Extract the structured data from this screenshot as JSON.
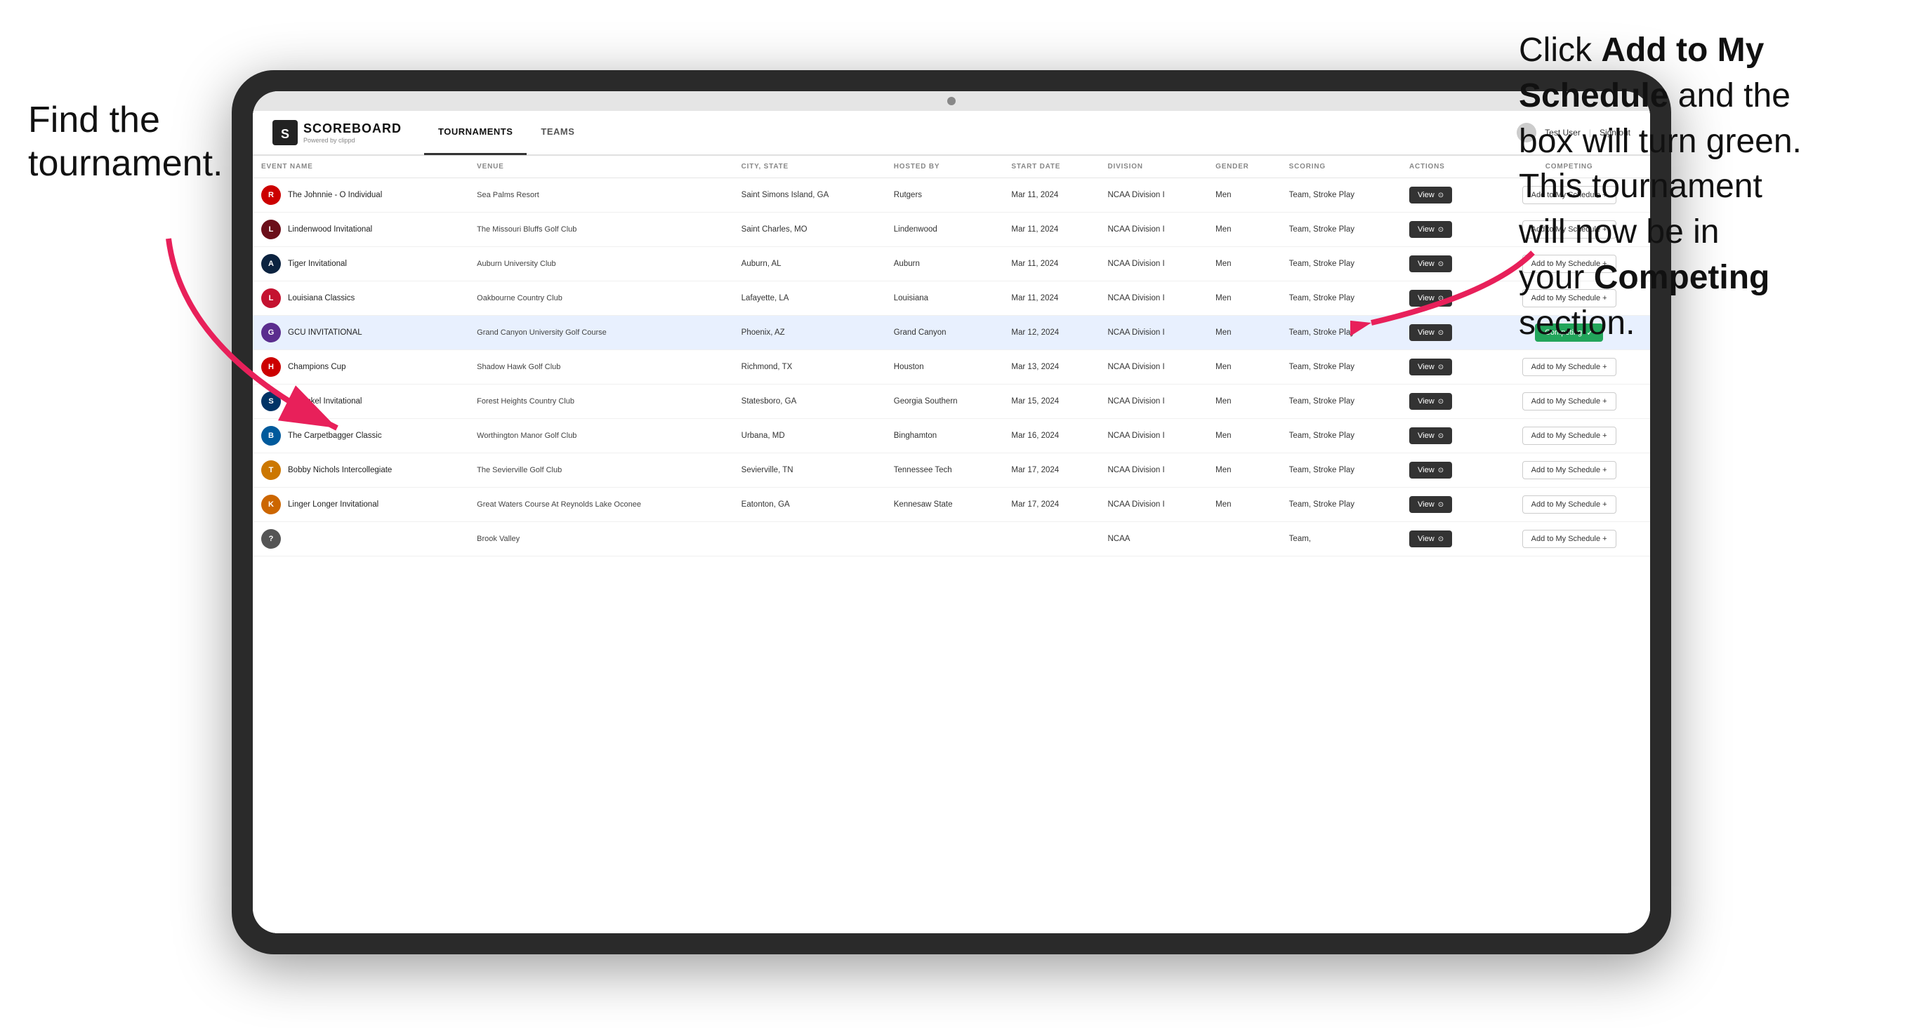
{
  "annotations": {
    "left": "Find the\ntournament.",
    "right_line1": "Click ",
    "right_bold1": "Add to My\nSchedule",
    "right_line2": " and the\nbox will turn green.\nThis tournament\nwill now be in\nyour ",
    "right_bold2": "Competing",
    "right_line3": "\nsection."
  },
  "header": {
    "logo_text": "SCOREBOARD",
    "logo_sub": "Powered by clippd",
    "tabs": [
      {
        "label": "TOURNAMENTS",
        "active": true
      },
      {
        "label": "TEAMS",
        "active": false
      }
    ],
    "user": "Test User",
    "signout": "Sign out"
  },
  "table": {
    "columns": [
      {
        "label": "EVENT NAME"
      },
      {
        "label": "VENUE"
      },
      {
        "label": "CITY, STATE"
      },
      {
        "label": "HOSTED BY"
      },
      {
        "label": "START DATE"
      },
      {
        "label": "DIVISION"
      },
      {
        "label": "GENDER"
      },
      {
        "label": "SCORING"
      },
      {
        "label": "ACTIONS"
      },
      {
        "label": "COMPETING"
      }
    ],
    "rows": [
      {
        "logo_color": "#cc0000",
        "logo_letter": "R",
        "event_name": "The Johnnie - O Individual",
        "venue": "Sea Palms Resort",
        "city_state": "Saint Simons Island, GA",
        "hosted_by": "Rutgers",
        "start_date": "Mar 11, 2024",
        "division": "NCAA Division I",
        "gender": "Men",
        "scoring": "Team, Stroke Play",
        "status": "add",
        "highlighted": false
      },
      {
        "logo_color": "#6b0f1a",
        "logo_letter": "L",
        "event_name": "Lindenwood Invitational",
        "venue": "The Missouri Bluffs Golf Club",
        "city_state": "Saint Charles, MO",
        "hosted_by": "Lindenwood",
        "start_date": "Mar 11, 2024",
        "division": "NCAA Division I",
        "gender": "Men",
        "scoring": "Team, Stroke Play",
        "status": "add",
        "highlighted": false
      },
      {
        "logo_color": "#0c2340",
        "logo_letter": "A",
        "event_name": "Tiger Invitational",
        "venue": "Auburn University Club",
        "city_state": "Auburn, AL",
        "hosted_by": "Auburn",
        "start_date": "Mar 11, 2024",
        "division": "NCAA Division I",
        "gender": "Men",
        "scoring": "Team, Stroke Play",
        "status": "add",
        "highlighted": false
      },
      {
        "logo_color": "#c41230",
        "logo_letter": "L",
        "event_name": "Louisiana Classics",
        "venue": "Oakbourne Country Club",
        "city_state": "Lafayette, LA",
        "hosted_by": "Louisiana",
        "start_date": "Mar 11, 2024",
        "division": "NCAA Division I",
        "gender": "Men",
        "scoring": "Team, Stroke Play",
        "status": "add",
        "highlighted": false
      },
      {
        "logo_color": "#5b2d8e",
        "logo_letter": "G",
        "event_name": "GCU INVITATIONAL",
        "venue": "Grand Canyon University Golf Course",
        "city_state": "Phoenix, AZ",
        "hosted_by": "Grand Canyon",
        "start_date": "Mar 12, 2024",
        "division": "NCAA Division I",
        "gender": "Men",
        "scoring": "Team, Stroke Play",
        "status": "competing",
        "highlighted": true
      },
      {
        "logo_color": "#cc0000",
        "logo_letter": "H",
        "event_name": "Champions Cup",
        "venue": "Shadow Hawk Golf Club",
        "city_state": "Richmond, TX",
        "hosted_by": "Houston",
        "start_date": "Mar 13, 2024",
        "division": "NCAA Division I",
        "gender": "Men",
        "scoring": "Team, Stroke Play",
        "status": "add",
        "highlighted": false
      },
      {
        "logo_color": "#003366",
        "logo_letter": "S",
        "event_name": "Schenkel Invitational",
        "venue": "Forest Heights Country Club",
        "city_state": "Statesboro, GA",
        "hosted_by": "Georgia Southern",
        "start_date": "Mar 15, 2024",
        "division": "NCAA Division I",
        "gender": "Men",
        "scoring": "Team, Stroke Play",
        "status": "add",
        "highlighted": false
      },
      {
        "logo_color": "#005a9c",
        "logo_letter": "B",
        "event_name": "The Carpetbagger Classic",
        "venue": "Worthington Manor Golf Club",
        "city_state": "Urbana, MD",
        "hosted_by": "Binghamton",
        "start_date": "Mar 16, 2024",
        "division": "NCAA Division I",
        "gender": "Men",
        "scoring": "Team, Stroke Play",
        "status": "add",
        "highlighted": false
      },
      {
        "logo_color": "#cc7700",
        "logo_letter": "T",
        "event_name": "Bobby Nichols Intercollegiate",
        "venue": "The Sevierville Golf Club",
        "city_state": "Sevierville, TN",
        "hosted_by": "Tennessee Tech",
        "start_date": "Mar 17, 2024",
        "division": "NCAA Division I",
        "gender": "Men",
        "scoring": "Team, Stroke Play",
        "status": "add",
        "highlighted": false
      },
      {
        "logo_color": "#cc6600",
        "logo_letter": "K",
        "event_name": "Linger Longer Invitational",
        "venue": "Great Waters Course At Reynolds Lake Oconee",
        "city_state": "Eatonton, GA",
        "hosted_by": "Kennesaw State",
        "start_date": "Mar 17, 2024",
        "division": "NCAA Division I",
        "gender": "Men",
        "scoring": "Team, Stroke Play",
        "status": "add",
        "highlighted": false
      },
      {
        "logo_color": "#555555",
        "logo_letter": "?",
        "event_name": "",
        "venue": "Brook Valley",
        "city_state": "",
        "hosted_by": "",
        "start_date": "",
        "division": "NCAA",
        "gender": "",
        "scoring": "Team,",
        "status": "add",
        "highlighted": false
      }
    ]
  },
  "buttons": {
    "view": "View",
    "add_schedule": "Add to My Schedule +",
    "competing": "Competing",
    "check": "✓"
  }
}
